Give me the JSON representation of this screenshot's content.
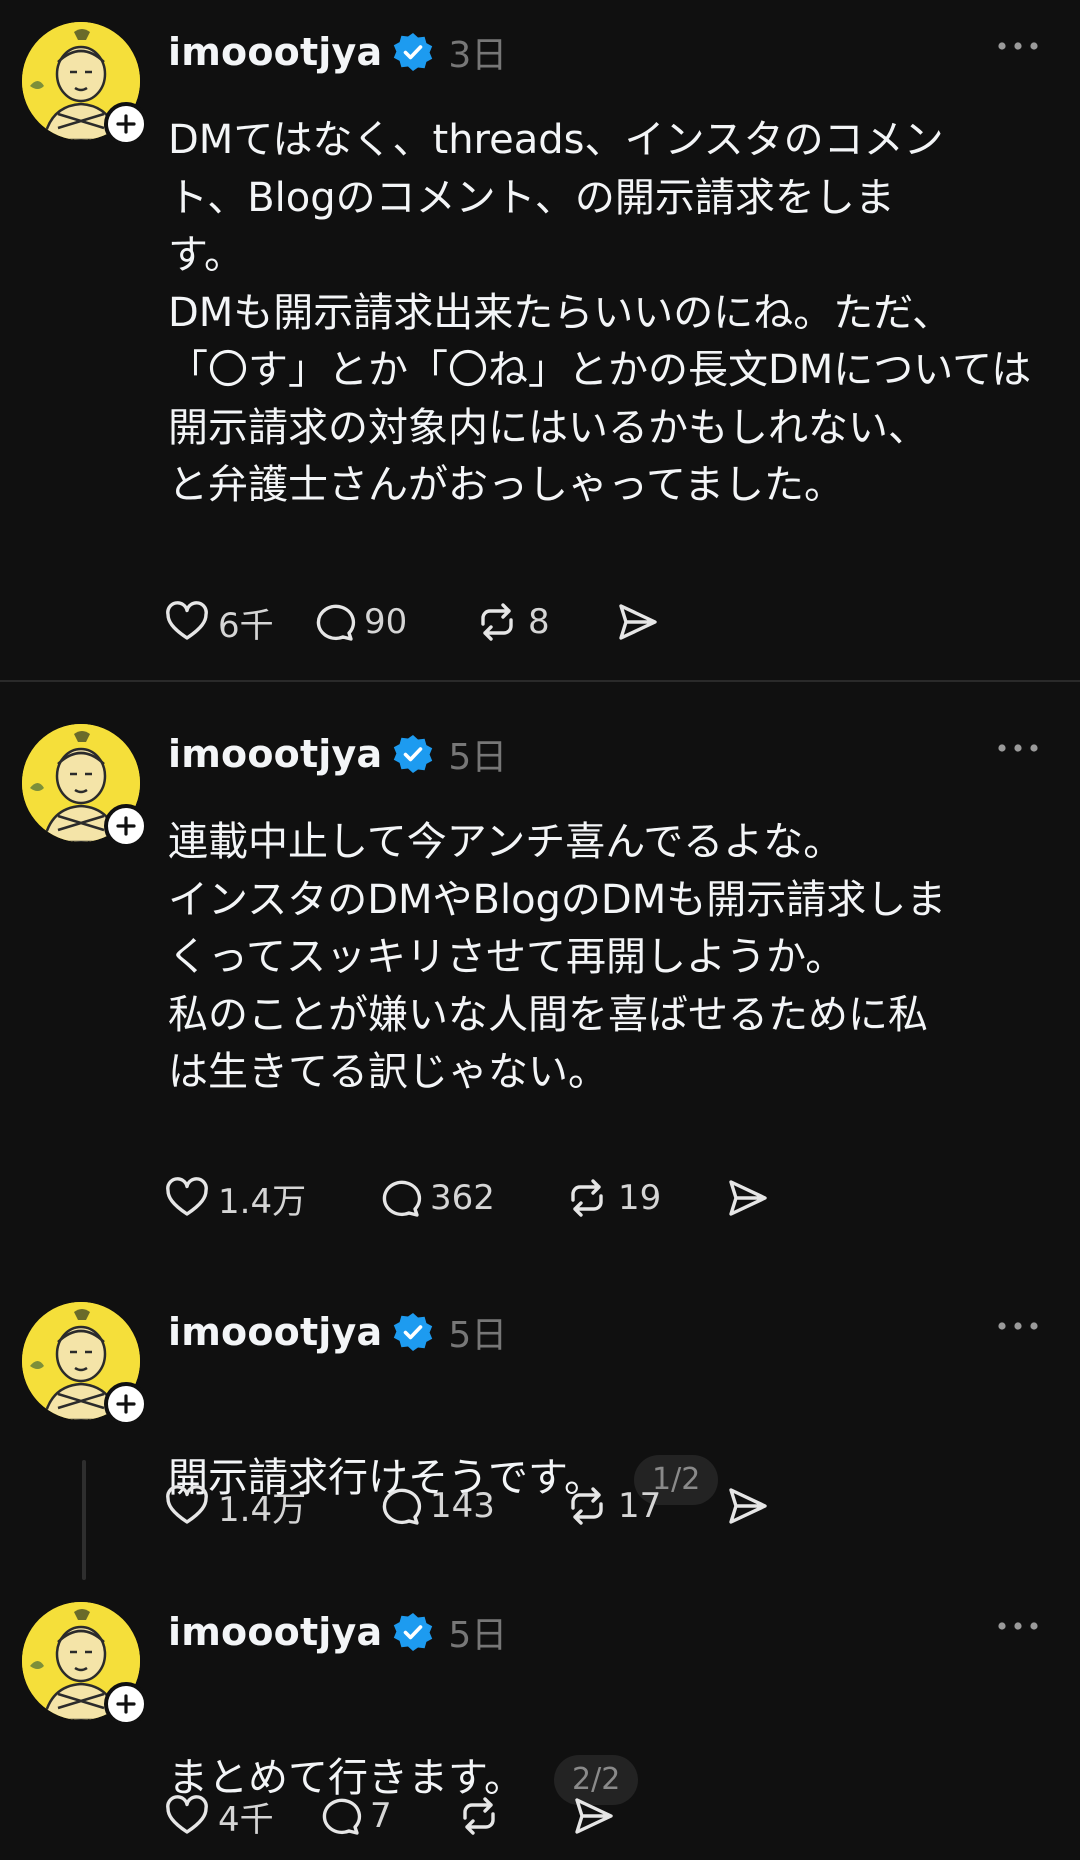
{
  "posts": [
    {
      "username": "imoootjya",
      "time": "3日",
      "text": "DMてはなく、threads、インスタのコメン\nト、Blogのコメント、の開示請求をしま\nす。\nDMも開示請求出来たらいいのにね。ただ、\n「〇す」とか「〇ね」とかの長文DMについては\n開示請求の対象内にはいるかもしれない、\nと弁護士さんがおっしゃってました。",
      "pager": "",
      "likes": "6千",
      "replies": "90",
      "reposts": "8"
    },
    {
      "username": "imoootjya",
      "time": "5日",
      "text": "連載中止して今アンチ喜んでるよな。\nインスタのDMやBlogのDMも開示請求しま\nくってスッキリさせて再開しようか。\n私のことが嫌いな人間を喜ばせるために私\nは生きてる訳じゃない。",
      "pager": "",
      "likes": "1.4万",
      "replies": "362",
      "reposts": "19"
    },
    {
      "username": "imoootjya",
      "time": "5日",
      "text": "開示請求行けそうです。",
      "pager": "1/2",
      "likes": "1.4万",
      "replies": "143",
      "reposts": "17"
    },
    {
      "username": "imoootjya",
      "time": "5日",
      "text": "まとめて行きます。",
      "pager": "2/2",
      "likes": "4千",
      "replies": "7",
      "reposts": ""
    }
  ],
  "icons": [
    "avatar-image",
    "follow-plus-icon",
    "verified-badge-icon",
    "more-options-icon",
    "heart-icon",
    "comment-icon",
    "repost-icon",
    "share-icon"
  ],
  "colors": {
    "background": "#101010",
    "text": "#f3f5f7",
    "muted": "#777777",
    "verified": "#1d9bf0",
    "avatar": "#f5df3a"
  }
}
